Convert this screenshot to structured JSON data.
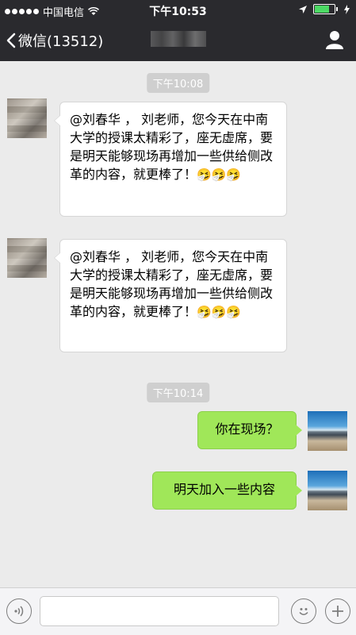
{
  "status_bar": {
    "carrier": "中国电信",
    "time": "下午10:53"
  },
  "nav": {
    "back_label": "微信(13512)",
    "title": ""
  },
  "messages": [
    {
      "time": "下午10:08",
      "sender": "other",
      "text": "@刘春华 ， 刘老师，您今天在中南大学的授课太精彩了，座无虚席，要是明天能够现场再增加一些供给侧改革的内容，就更棒了！",
      "emoji": "🤧🤧🤧"
    },
    {
      "sender": "other",
      "text": "@刘春华 ， 刘老师，您今天在中南大学的授课太精彩了，座无虚席，要是明天能够现场再增加一些供给侧改革的内容，就更棒了！",
      "emoji": "🤧🤧🤧"
    },
    {
      "time": "下午10:14",
      "sender": "me",
      "text": "你在现场？"
    },
    {
      "sender": "me",
      "text": "明天加入一些内容"
    }
  ],
  "input_bar": {
    "input_value": ""
  },
  "colors": {
    "nav_bg": "#2a2a2e",
    "chat_bg": "#ebebeb",
    "my_bubble": "#a0e759",
    "other_bubble": "#ffffff"
  }
}
